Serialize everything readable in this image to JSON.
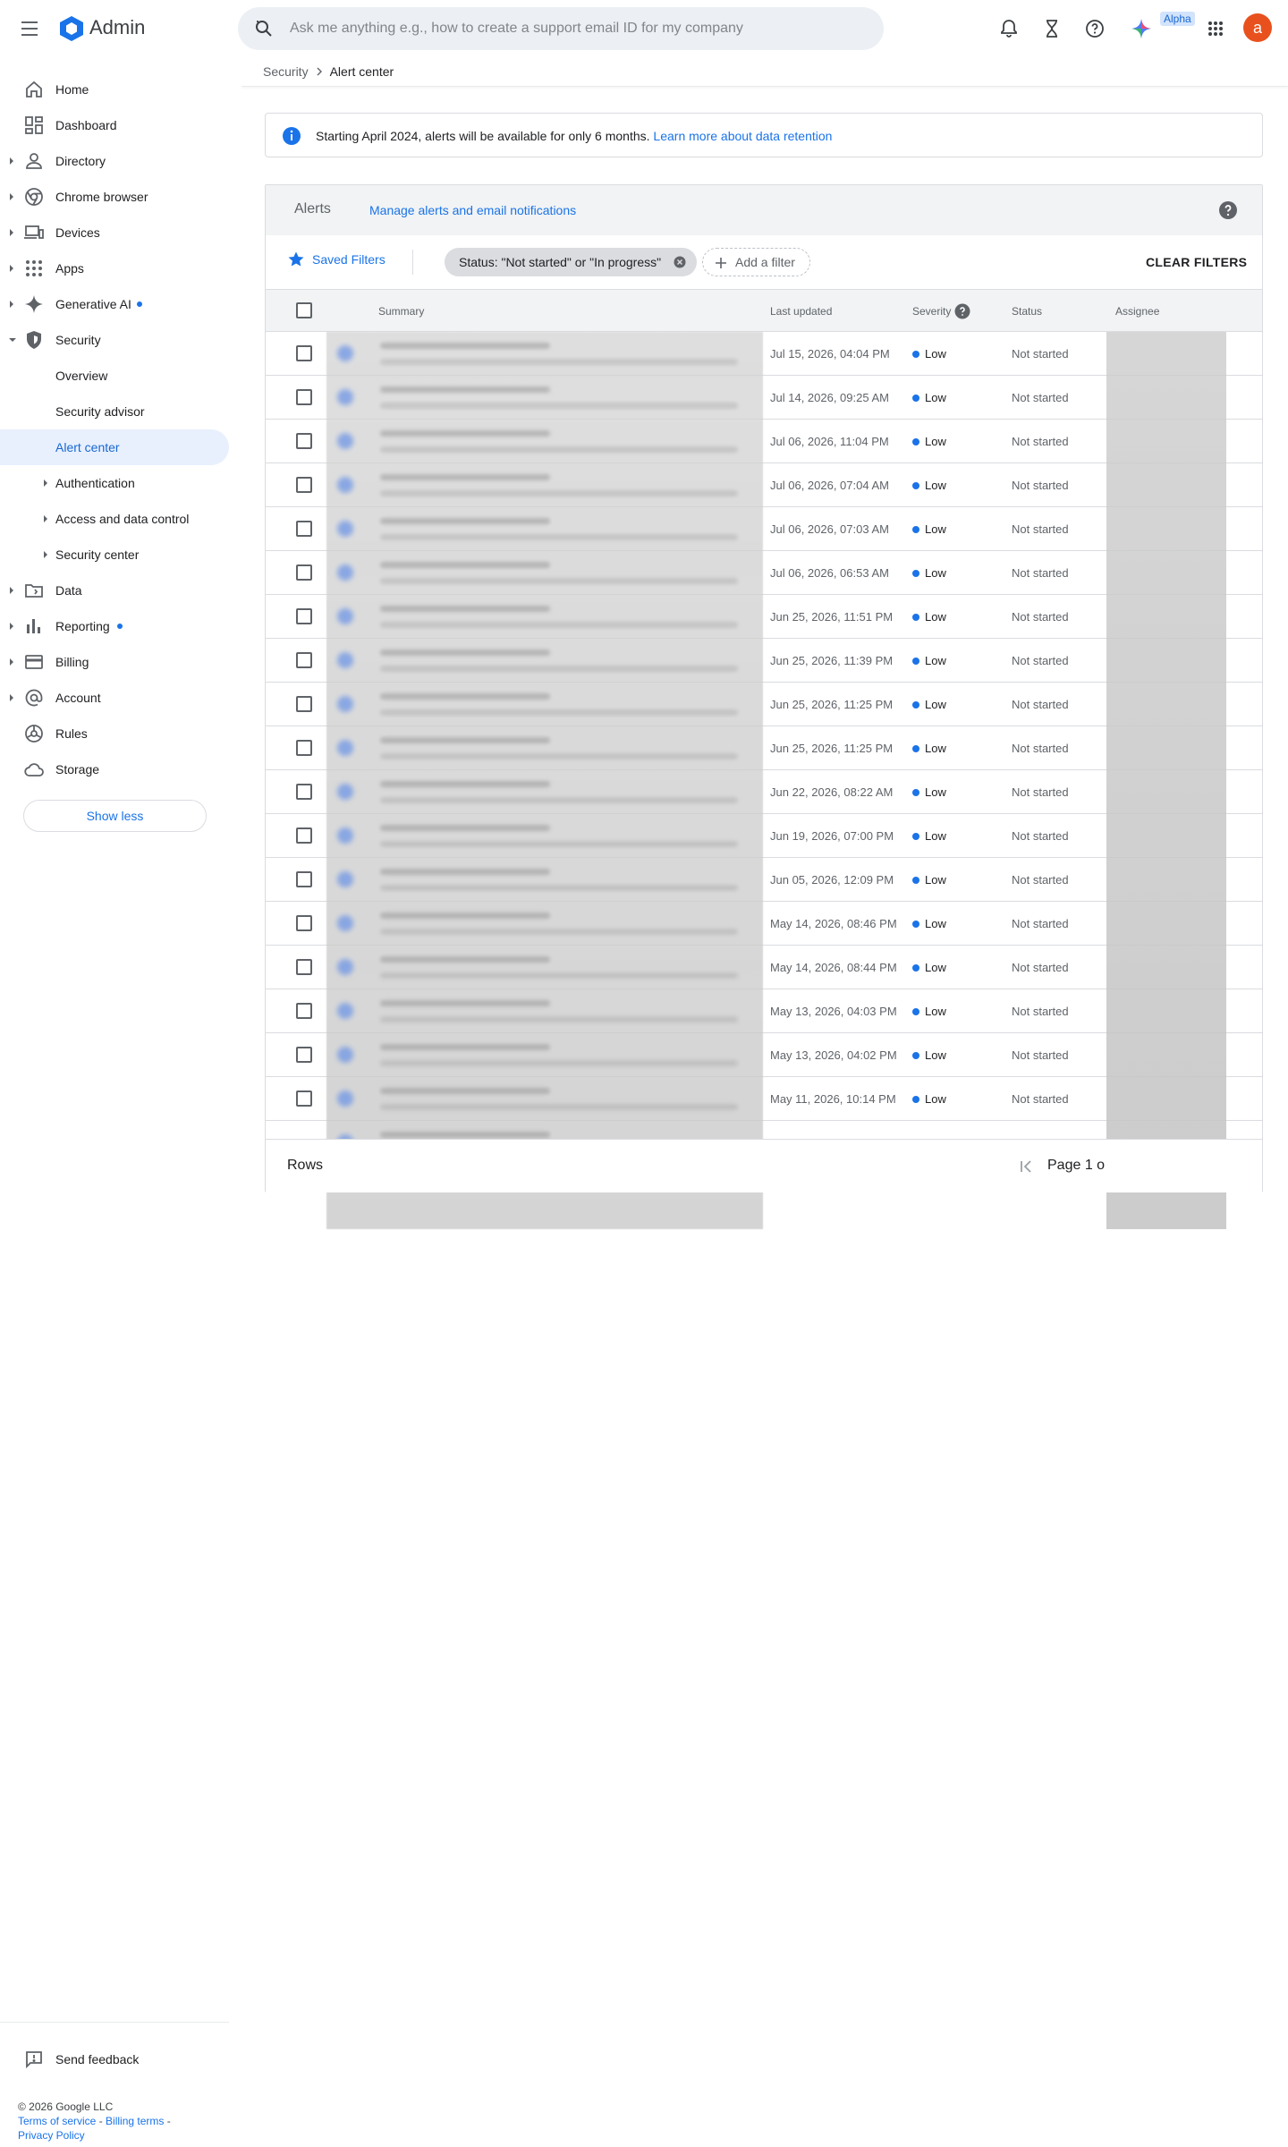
{
  "app": {
    "title": "Admin"
  },
  "search": {
    "placeholder": "Ask me anything e.g., how to create a support email ID for my company"
  },
  "topbar": {
    "alpha_badge": "Alpha",
    "avatar_letter": "a"
  },
  "sidebar": {
    "items": [
      {
        "label": "Home",
        "icon": "home-icon"
      },
      {
        "label": "Dashboard",
        "icon": "dashboard-icon"
      },
      {
        "label": "Directory",
        "icon": "person-icon"
      },
      {
        "label": "Chrome browser",
        "icon": "chrome-icon"
      },
      {
        "label": "Devices",
        "icon": "devices-icon"
      },
      {
        "label": "Apps",
        "icon": "apps-grid-icon"
      },
      {
        "label": "Generative AI",
        "icon": "sparkle-icon"
      },
      {
        "label": "Security",
        "icon": "shield-icon"
      },
      {
        "label": "Overview"
      },
      {
        "label": "Security advisor"
      },
      {
        "label": "Alert center"
      },
      {
        "label": "Authentication"
      },
      {
        "label": "Access and data control"
      },
      {
        "label": "Security center"
      },
      {
        "label": "Data",
        "icon": "folder-icon"
      },
      {
        "label": "Reporting",
        "icon": "bar-chart-icon"
      },
      {
        "label": "Billing",
        "icon": "credit-card-icon"
      },
      {
        "label": "Account",
        "icon": "at-sign-icon"
      },
      {
        "label": "Rules",
        "icon": "rules-icon"
      },
      {
        "label": "Storage",
        "icon": "cloud-icon"
      }
    ],
    "show_less": "Show less",
    "send_feedback": "Send feedback"
  },
  "footer": {
    "copyright": "© 2026 Google LLC",
    "terms": "Terms of service",
    "billing_terms": "Billing terms",
    "privacy": "Privacy Policy"
  },
  "breadcrumb": {
    "parent": "Security",
    "current": "Alert center"
  },
  "banner": {
    "text": "Starting April 2024, alerts will be available for only 6 months.",
    "link": "Learn more about data retention"
  },
  "alerts": {
    "title": "Alerts",
    "manage_link": "Manage alerts and email notifications",
    "saved_filters": "Saved Filters",
    "filter_chip": "Status: \"Not started\" or \"In progress\"",
    "add_filter": "Add a filter",
    "clear_filters": "CLEAR FILTERS",
    "columns": {
      "summary": "Summary",
      "last_updated": "Last updated",
      "severity": "Severity",
      "status": "Status",
      "assignee": "Assignee"
    },
    "rows": [
      {
        "date": "Jul 15, 2026, 04:04 PM",
        "severity": "Low",
        "status": "Not started"
      },
      {
        "date": "Jul 14, 2026, 09:25 AM",
        "severity": "Low",
        "status": "Not started"
      },
      {
        "date": "Jul 06, 2026, 11:04 PM",
        "severity": "Low",
        "status": "Not started"
      },
      {
        "date": "Jul 06, 2026, 07:04 AM",
        "severity": "Low",
        "status": "Not started"
      },
      {
        "date": "Jul 06, 2026, 07:03 AM",
        "severity": "Low",
        "status": "Not started"
      },
      {
        "date": "Jul 06, 2026, 06:53 AM",
        "severity": "Low",
        "status": "Not started"
      },
      {
        "date": "Jun 25, 2026, 11:51 PM",
        "severity": "Low",
        "status": "Not started"
      },
      {
        "date": "Jun 25, 2026, 11:39 PM",
        "severity": "Low",
        "status": "Not started"
      },
      {
        "date": "Jun 25, 2026, 11:25 PM",
        "severity": "Low",
        "status": "Not started"
      },
      {
        "date": "Jun 25, 2026, 11:25 PM",
        "severity": "Low",
        "status": "Not started"
      },
      {
        "date": "Jun 22, 2026, 08:22 AM",
        "severity": "Low",
        "status": "Not started"
      },
      {
        "date": "Jun 19, 2026, 07:00 PM",
        "severity": "Low",
        "status": "Not started"
      },
      {
        "date": "Jun 05, 2026, 12:09 PM",
        "severity": "Low",
        "status": "Not started"
      },
      {
        "date": "May 14, 2026, 08:46 PM",
        "severity": "Low",
        "status": "Not started"
      },
      {
        "date": "May 14, 2026, 08:44 PM",
        "severity": "Low",
        "status": "Not started"
      },
      {
        "date": "May 13, 2026, 04:03 PM",
        "severity": "Low",
        "status": "Not started"
      },
      {
        "date": "May 13, 2026, 04:02 PM",
        "severity": "Low",
        "status": "Not started"
      },
      {
        "date": "May 11, 2026, 10:14 PM",
        "severity": "Low",
        "status": "Not started"
      }
    ],
    "pager": {
      "rows_label": "Rows",
      "page_label": "Page 1 o"
    }
  },
  "colors": {
    "accent": "#1a73e8",
    "active_bg": "#e8f0fe",
    "avatar": "#e8511d",
    "severity_low": "#1a73e8"
  }
}
